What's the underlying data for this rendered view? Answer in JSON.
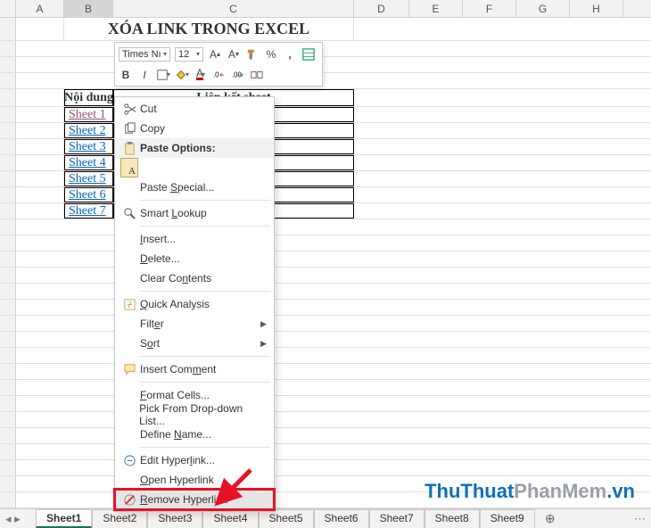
{
  "columns": [
    "A",
    "B",
    "C",
    "D",
    "E",
    "F",
    "G",
    "H"
  ],
  "selected_col": "B",
  "title_cell": "XÓA LINK TRONG EXCEL",
  "table": {
    "headers": {
      "col1": "Nội dung",
      "col2": "Liên kết sheet"
    },
    "rows": [
      {
        "link": "Sheet 1",
        "visited": true
      },
      {
        "link": "Sheet 2",
        "visited": false
      },
      {
        "link": "Sheet 3",
        "visited": false
      },
      {
        "link": "Sheet 4",
        "visited": false
      },
      {
        "link": "Sheet 5",
        "visited": false
      },
      {
        "link": "Sheet 6",
        "visited": false
      },
      {
        "link": "Sheet 7",
        "visited": false
      }
    ]
  },
  "minitoolbar": {
    "font": "Times Nı",
    "size": "12",
    "buttons_row1": [
      "increase-font",
      "decrease-font",
      "format-painter",
      "percent",
      "comma",
      "table-format"
    ],
    "buttons_row2": [
      "bold",
      "italic",
      "border",
      "fill-color",
      "font-color",
      "decrease-decimal",
      "increase-decimal",
      "merge"
    ]
  },
  "context_menu": {
    "items": [
      {
        "id": "cut",
        "label": "Cut",
        "icon": "scissors"
      },
      {
        "id": "copy",
        "label": "Copy",
        "icon": "copy"
      },
      {
        "id": "paste-options",
        "label": "Paste Options:",
        "icon": "clipboard",
        "heading": true
      },
      {
        "id": "paste-keep-text",
        "label": "A",
        "icon": "paste-a",
        "indent": true
      },
      {
        "id": "paste-special",
        "label": "Paste Special...",
        "underline_index": 6
      },
      {
        "sep": true
      },
      {
        "id": "smart-lookup",
        "label": "Smart Lookup",
        "icon": "search",
        "underline_index": 6
      },
      {
        "sep": true
      },
      {
        "id": "insert",
        "label": "Insert...",
        "underline_index": 0
      },
      {
        "id": "delete",
        "label": "Delete...",
        "underline_index": 0
      },
      {
        "id": "clear-contents",
        "label": "Clear Contents",
        "underline_index": 8
      },
      {
        "sep": true
      },
      {
        "id": "quick-analysis",
        "label": "Quick Analysis",
        "icon": "quick",
        "underline_index": 0
      },
      {
        "id": "filter",
        "label": "Filter",
        "submenu": true,
        "underline_index": 4
      },
      {
        "id": "sort",
        "label": "Sort",
        "submenu": true,
        "underline_index": 1
      },
      {
        "sep": true
      },
      {
        "id": "insert-comment",
        "label": "Insert Comment",
        "icon": "comment",
        "underline_index": 10
      },
      {
        "sep": true
      },
      {
        "id": "format-cells",
        "label": "Format Cells...",
        "icon": "",
        "underline_index": 0
      },
      {
        "id": "pick-list",
        "label": "Pick From Drop-down List...",
        "underline_index": 19
      },
      {
        "id": "define-name",
        "label": "Define Name...",
        "underline_index": 7
      },
      {
        "sep": true
      },
      {
        "id": "edit-hyperlink",
        "label": "Edit Hyperlink...",
        "icon": "link",
        "underline_index": 10
      },
      {
        "id": "open-hyperlink",
        "label": "Open Hyperlink",
        "underline_index": 0
      },
      {
        "id": "remove-hyperlink",
        "label": "Remove Hyperlink",
        "icon": "unlink",
        "underline_index": 0,
        "highlight": true
      }
    ]
  },
  "tabs": [
    "Sheet1",
    "Sheet2",
    "Sheet3",
    "Sheet4",
    "Sheet5",
    "Sheet6",
    "Sheet7",
    "Sheet8",
    "Sheet9"
  ],
  "active_tab": "Sheet1",
  "watermark": {
    "part1": "ThuThuat",
    "part2": "PhanMem",
    "part3": ".vn"
  }
}
